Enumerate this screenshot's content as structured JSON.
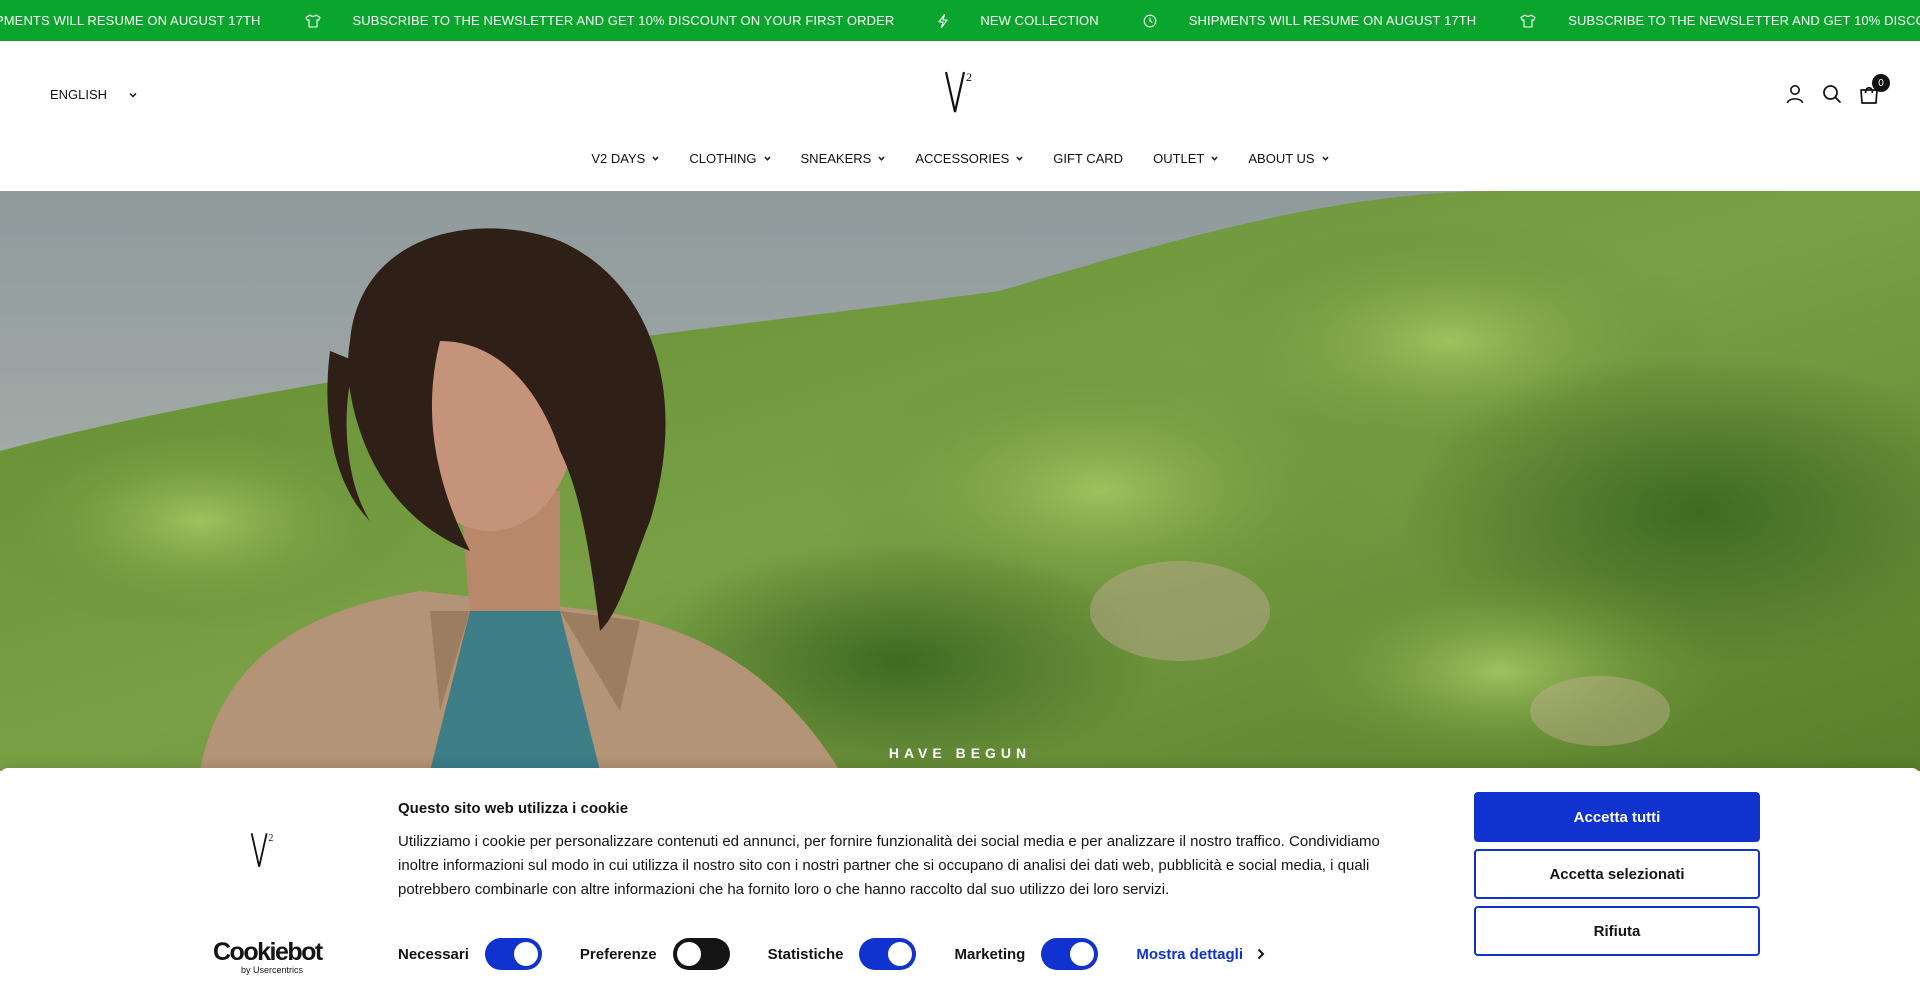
{
  "announcement": {
    "items": [
      {
        "icon": "lightning-icon",
        "text": "SHIPMENTS WILL RESUME ON AUGUST 17TH"
      },
      {
        "icon": "tshirt-icon",
        "text": "SUBSCRIBE TO THE NEWSLETTER AND GET 10% DISCOUNT ON YOUR FIRST ORDER"
      },
      {
        "icon": "lightning-icon",
        "text": "NEW COLLECTION"
      },
      {
        "icon": "clock-icon",
        "text": "SHIPMENTS WILL RESUME ON AUGUST 17TH"
      },
      {
        "icon": "tshirt-icon",
        "text": "SUBSCRIBE TO THE NEWSLETTER AND GET 10% DISCOUNT ON YOUR FIRST ORDER"
      },
      {
        "icon": "lightning-icon",
        "text": "NEW COLLECTION"
      },
      {
        "icon": "clock-icon",
        "text": "SHIPMENTS WILL RESUME ON AUGUST 17TH"
      }
    ],
    "color": "#0aa52c"
  },
  "header": {
    "language": "ENGLISH",
    "logo_text": "V2",
    "cart_count": "0"
  },
  "nav": {
    "items": [
      {
        "label": "V2 DAYS",
        "dropdown": true
      },
      {
        "label": "CLOTHING",
        "dropdown": true
      },
      {
        "label": "SNEAKERS",
        "dropdown": true
      },
      {
        "label": "ACCESSORIES",
        "dropdown": true
      },
      {
        "label": "GIFT CARD",
        "dropdown": false
      },
      {
        "label": "OUTLET",
        "dropdown": true
      },
      {
        "label": "ABOUT US",
        "dropdown": true
      }
    ]
  },
  "hero": {
    "text": "HAVE BEGUN"
  },
  "cookie": {
    "title": "Questo sito web utilizza i cookie",
    "body": "Utilizziamo i cookie per personalizzare contenuti ed annunci, per fornire funzionalità dei social media e per analizzare il nostro traffico. Condividiamo inoltre informazioni sul modo in cui utilizza il nostro sito con i nostri partner che si occupano di analisi dei dati web, pubblicità e social media, i quali potrebbero combinarle con altre informazioni che ha fornito loro o che hanno raccolto dal suo utilizzo dei loro servizi.",
    "brand": "Cookiebot",
    "brand_sub": "by Usercentrics",
    "toggles": [
      {
        "label": "Necessari",
        "on": true
      },
      {
        "label": "Preferenze",
        "on": false
      },
      {
        "label": "Statistiche",
        "on": true
      },
      {
        "label": "Marketing",
        "on": true
      }
    ],
    "details_label": "Mostra dettagli",
    "buttons": {
      "accept_all": "Accetta tutti",
      "accept_selected": "Accetta selezionati",
      "reject": "Rifiuta"
    },
    "accent_color": "#1032cf"
  }
}
